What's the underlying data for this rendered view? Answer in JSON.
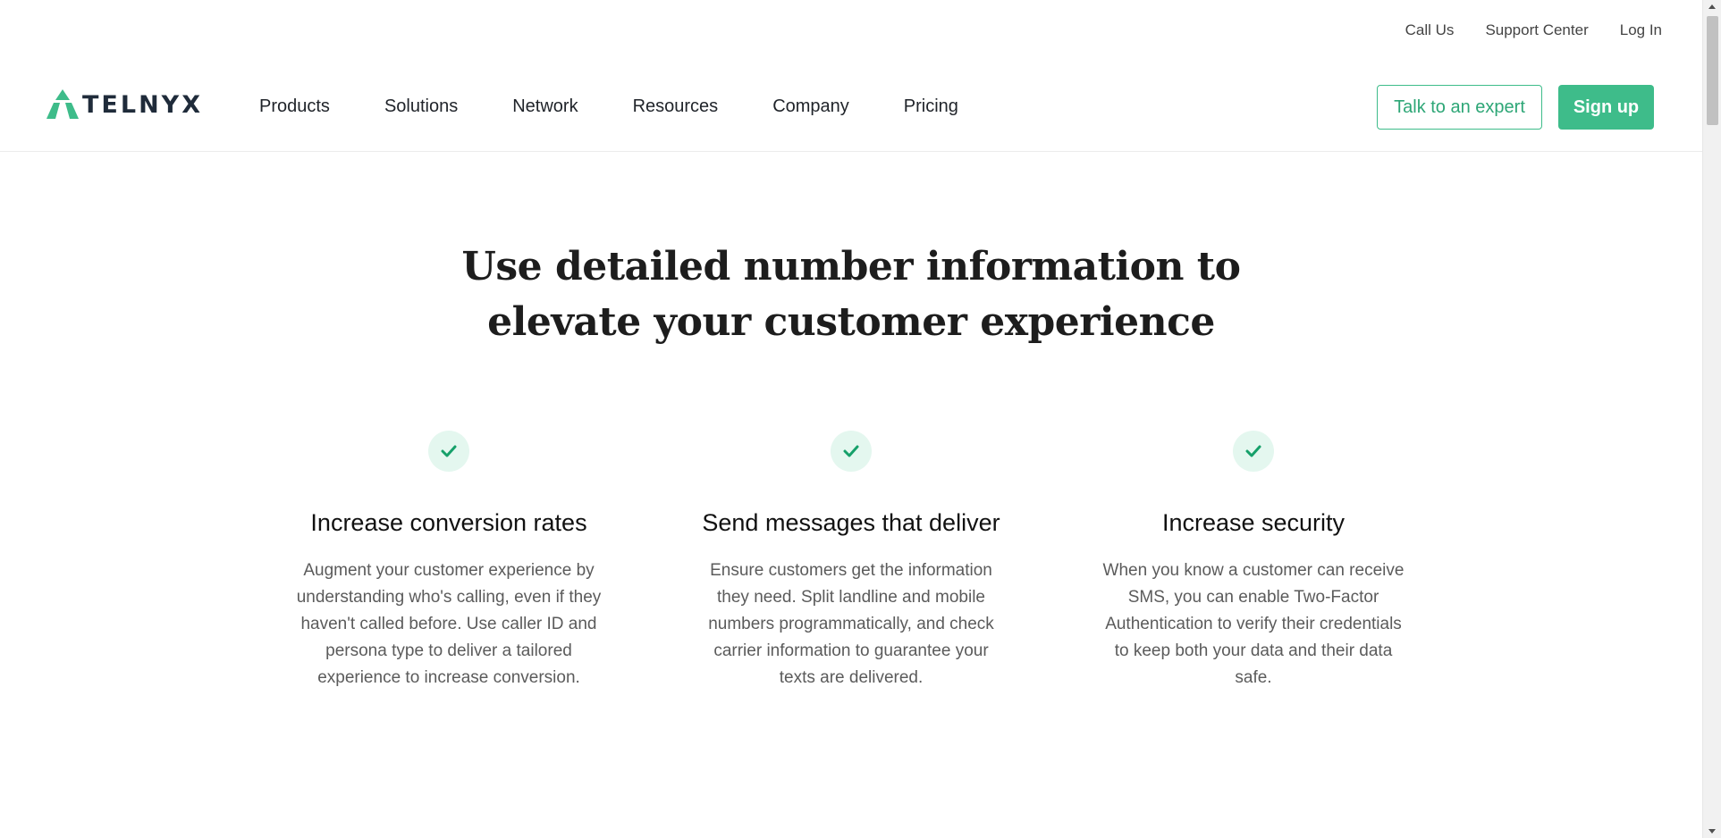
{
  "utility_nav": {
    "call_us": "Call Us",
    "support_center": "Support Center",
    "log_in": "Log In"
  },
  "brand": {
    "logo_text": "TELNYX",
    "accent_color": "#3ebc8a"
  },
  "main_nav": {
    "items": [
      "Products",
      "Solutions",
      "Network",
      "Resources",
      "Company",
      "Pricing"
    ]
  },
  "cta": {
    "talk_to_expert": "Talk to an expert",
    "sign_up": "Sign up"
  },
  "hero": {
    "headline_line1": "Use detailed number information to",
    "headline_line2": "elevate your customer experience"
  },
  "features": [
    {
      "icon": "check-icon",
      "title": "Increase conversion rates",
      "text": "Augment your customer experience by understanding who's calling, even if they haven't called before. Use caller ID and persona type to deliver a tailored experience to increase conversion."
    },
    {
      "icon": "check-icon",
      "title": "Send messages that deliver",
      "text": "Ensure customers get the information they need. Split landline and mobile numbers programmatically, and check carrier information to guarantee your texts are delivered."
    },
    {
      "icon": "check-icon",
      "title": "Increase security",
      "text": "When you know a customer can receive SMS, you can enable Two-Factor Authentication to verify their credentials to keep both your data and their data safe."
    }
  ]
}
